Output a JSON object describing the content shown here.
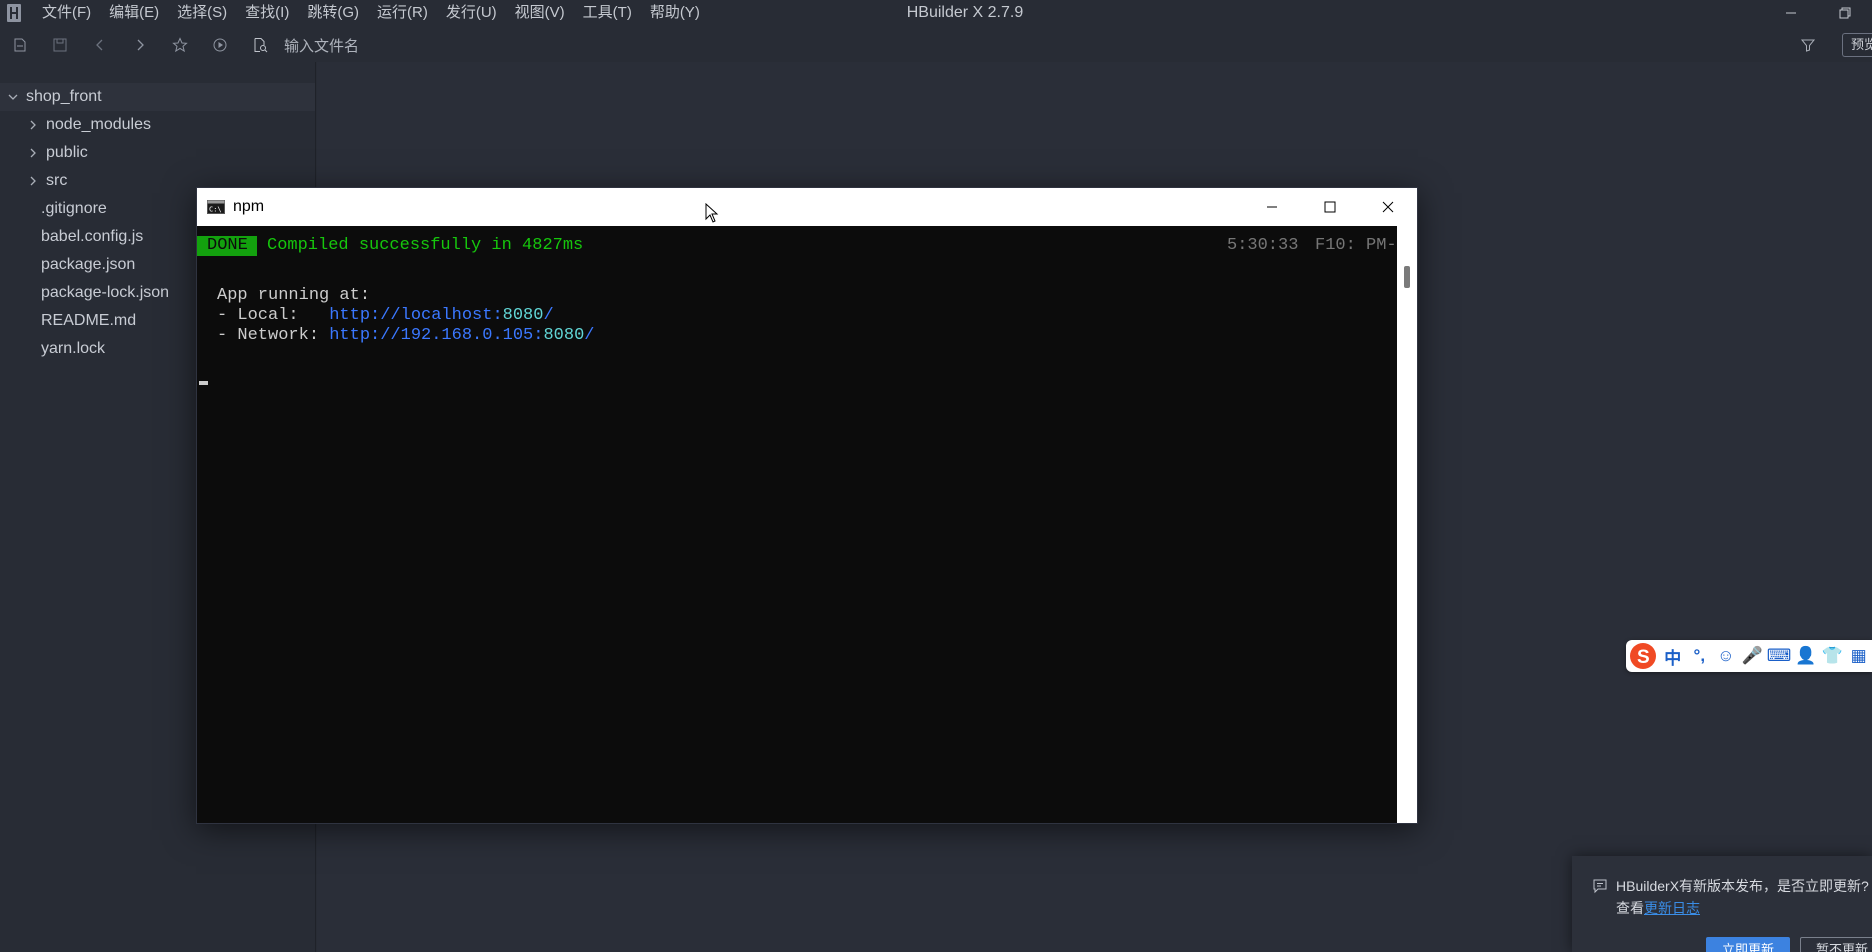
{
  "window": {
    "title": "HBuilder X 2.7.9"
  },
  "menu": [
    "文件(F)",
    "编辑(E)",
    "选择(S)",
    "查找(I)",
    "跳转(G)",
    "运行(R)",
    "发行(U)",
    "视图(V)",
    "工具(T)",
    "帮助(Y)"
  ],
  "toolbar": {
    "file_search_placeholder": "输入文件名",
    "preview_label": "预览"
  },
  "sidebar": {
    "root": "shop_front",
    "folders": [
      "node_modules",
      "public",
      "src"
    ],
    "files": [
      ".gitignore",
      "babel.config.js",
      "package.json",
      "package-lock.json",
      "README.md",
      "yarn.lock"
    ]
  },
  "terminal": {
    "title": "npm",
    "done_badge": "DONE",
    "compiled": "Compiled successfully in 4827ms",
    "timestamp": "5:30:33",
    "status_tag": "F10: PM-",
    "running_at": "App running at:",
    "local_label": "- Local:   ",
    "local_url": "http://localhost:",
    "local_port": "8080",
    "local_slash": "/",
    "network_label": "- Network: ",
    "network_url": "http://192.168.0.105:",
    "network_port": "8080",
    "network_slash": "/"
  },
  "ime": {
    "items": [
      "中",
      "°,",
      "☺",
      "🎤",
      "⌨",
      "👤",
      "👕",
      "▦"
    ]
  },
  "notification": {
    "message": "HBuilderX有新版本发布，是否立即更新?",
    "view_prefix": "查看",
    "changelog_link": "更新日志",
    "update_now": "立即更新",
    "later": "暂不更新"
  },
  "colors": {
    "bg": "#282c35",
    "editor_bg": "#2a2e38",
    "terminal_bg": "#0c0c0c",
    "done_green": "#13a10e",
    "compiled_green": "#16c60c",
    "url_blue": "#3b78ff",
    "port_cyan": "#61d6d6",
    "accent_blue": "#3c82e0"
  }
}
